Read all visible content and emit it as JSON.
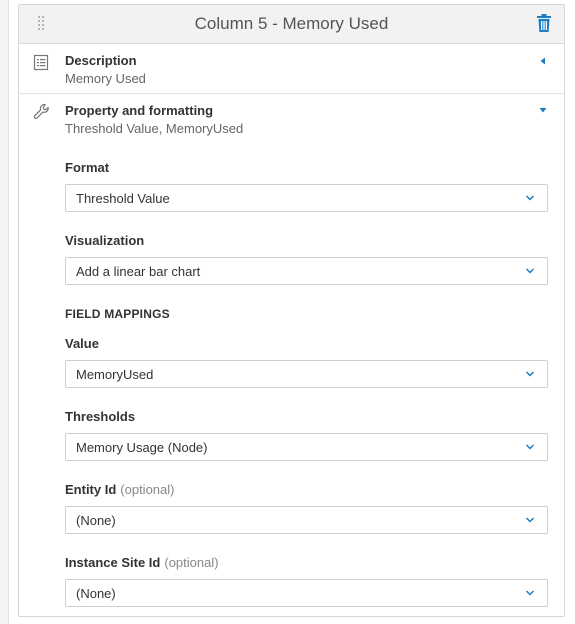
{
  "panel": {
    "title": "Column 5 - Memory Used"
  },
  "description_section": {
    "title": "Description",
    "subtitle": "Memory Used",
    "icon": "list-icon",
    "expanded": false
  },
  "property_section": {
    "title": "Property and formatting",
    "subtitle": "Threshold Value, MemoryUsed",
    "icon": "wrench-icon",
    "expanded": true,
    "format": {
      "label": "Format",
      "value": "Threshold Value"
    },
    "visualization": {
      "label": "Visualization",
      "value": "Add a linear bar chart"
    },
    "field_mappings_heading": "FIELD MAPPINGS",
    "value_field": {
      "label": "Value",
      "value": "MemoryUsed"
    },
    "thresholds": {
      "label": "Thresholds",
      "value": "Memory Usage (Node)"
    },
    "entity_id": {
      "label": "Entity Id",
      "optional": "(optional)",
      "value": "(None)"
    },
    "instance_site_id": {
      "label": "Instance Site Id",
      "optional": "(optional)",
      "value": "(None)"
    }
  },
  "colors": {
    "accent": "#1a7dc4",
    "header_bg": "#f2f2f2",
    "border": "#d6d6d6"
  }
}
